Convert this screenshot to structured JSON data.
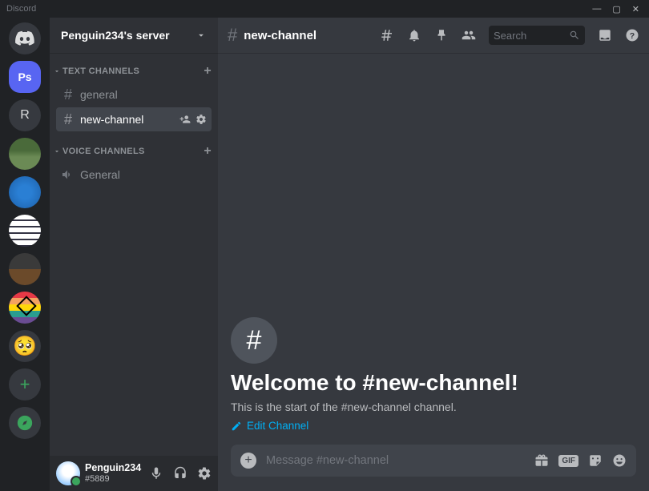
{
  "app": {
    "name": "Discord"
  },
  "server": {
    "name": "Penguin234's server"
  },
  "categories": {
    "text": {
      "label": "TEXT CHANNELS",
      "channels": [
        {
          "name": "general"
        },
        {
          "name": "new-channel"
        }
      ]
    },
    "voice": {
      "label": "VOICE CHANNELS",
      "channels": [
        {
          "name": "General"
        }
      ]
    }
  },
  "current_channel": {
    "name": "new-channel"
  },
  "search": {
    "placeholder": "Search"
  },
  "welcome": {
    "title": "Welcome to #new-channel!",
    "subtitle": "This is the start of the #new-channel channel.",
    "edit_label": "Edit Channel"
  },
  "composer": {
    "placeholder": "Message #new-channel",
    "gif_label": "GIF"
  },
  "user": {
    "name": "Penguin234",
    "tag": "#5889"
  },
  "guilds": {
    "ps": "Ps",
    "r": "R"
  }
}
